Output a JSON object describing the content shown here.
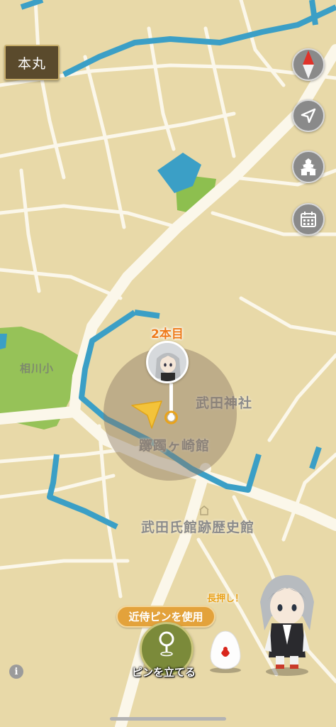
{
  "header": {
    "honmaru_label": "本丸"
  },
  "controls": {
    "compass": "compass-icon",
    "locate": "location-arrow-icon",
    "castle": "castle-icon",
    "calendar": "calendar-icon"
  },
  "map": {
    "labels": {
      "shrine": "武田神社",
      "site": "躑躅ヶ崎館",
      "museum": "武田氏館跡歴史館",
      "school": "相川小"
    },
    "pin_count": "2本目"
  },
  "bottom": {
    "use_pin_label": "近侍ピンを使用",
    "place_pin_label": "ピンを立てる",
    "long_press_label": "長押し！",
    "info_label": "i"
  },
  "colors": {
    "map_background": "#e8d9a8",
    "water": "#3b9fc6",
    "park": "#8dbf4f",
    "accent_orange": "#e3a23b",
    "pin_button_green": "#7b8a3a"
  }
}
